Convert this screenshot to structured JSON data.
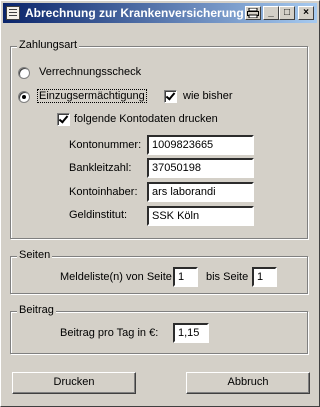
{
  "window": {
    "title": "Abrechnung zur Krankenversicherung"
  },
  "title_buttons": {
    "print": "",
    "minimize": "_",
    "maximize": "□",
    "close": "×"
  },
  "zahlungsart": {
    "label": "Zahlungsart",
    "verrechnungsscheck": "Verrechnungsscheck",
    "einzugsermaechtigung": "Einzugsermächtigung",
    "wie_bisher": "wie bisher",
    "folgende_kontodaten": "folgende Kontodaten drucken",
    "fields": [
      {
        "label": "Kontonummer:",
        "value": "1009823665"
      },
      {
        "label": "Bankleitzahl:",
        "value": "37050198"
      },
      {
        "label": "Kontoinhaber:",
        "value": "ars laborandi"
      },
      {
        "label": "Geldinstitut:",
        "value": "SSK Köln"
      }
    ]
  },
  "seiten": {
    "label": "Seiten",
    "von_label": "Meldeliste(n) von Seite",
    "von_value": "1",
    "bis_label": "bis Seite",
    "bis_value": "1"
  },
  "beitrag": {
    "label": "Beitrag",
    "pro_tag_label": "Beitrag pro Tag in €:",
    "pro_tag_value": "1,15"
  },
  "buttons": {
    "drucken": "Drucken",
    "abbruch": "Abbruch"
  }
}
